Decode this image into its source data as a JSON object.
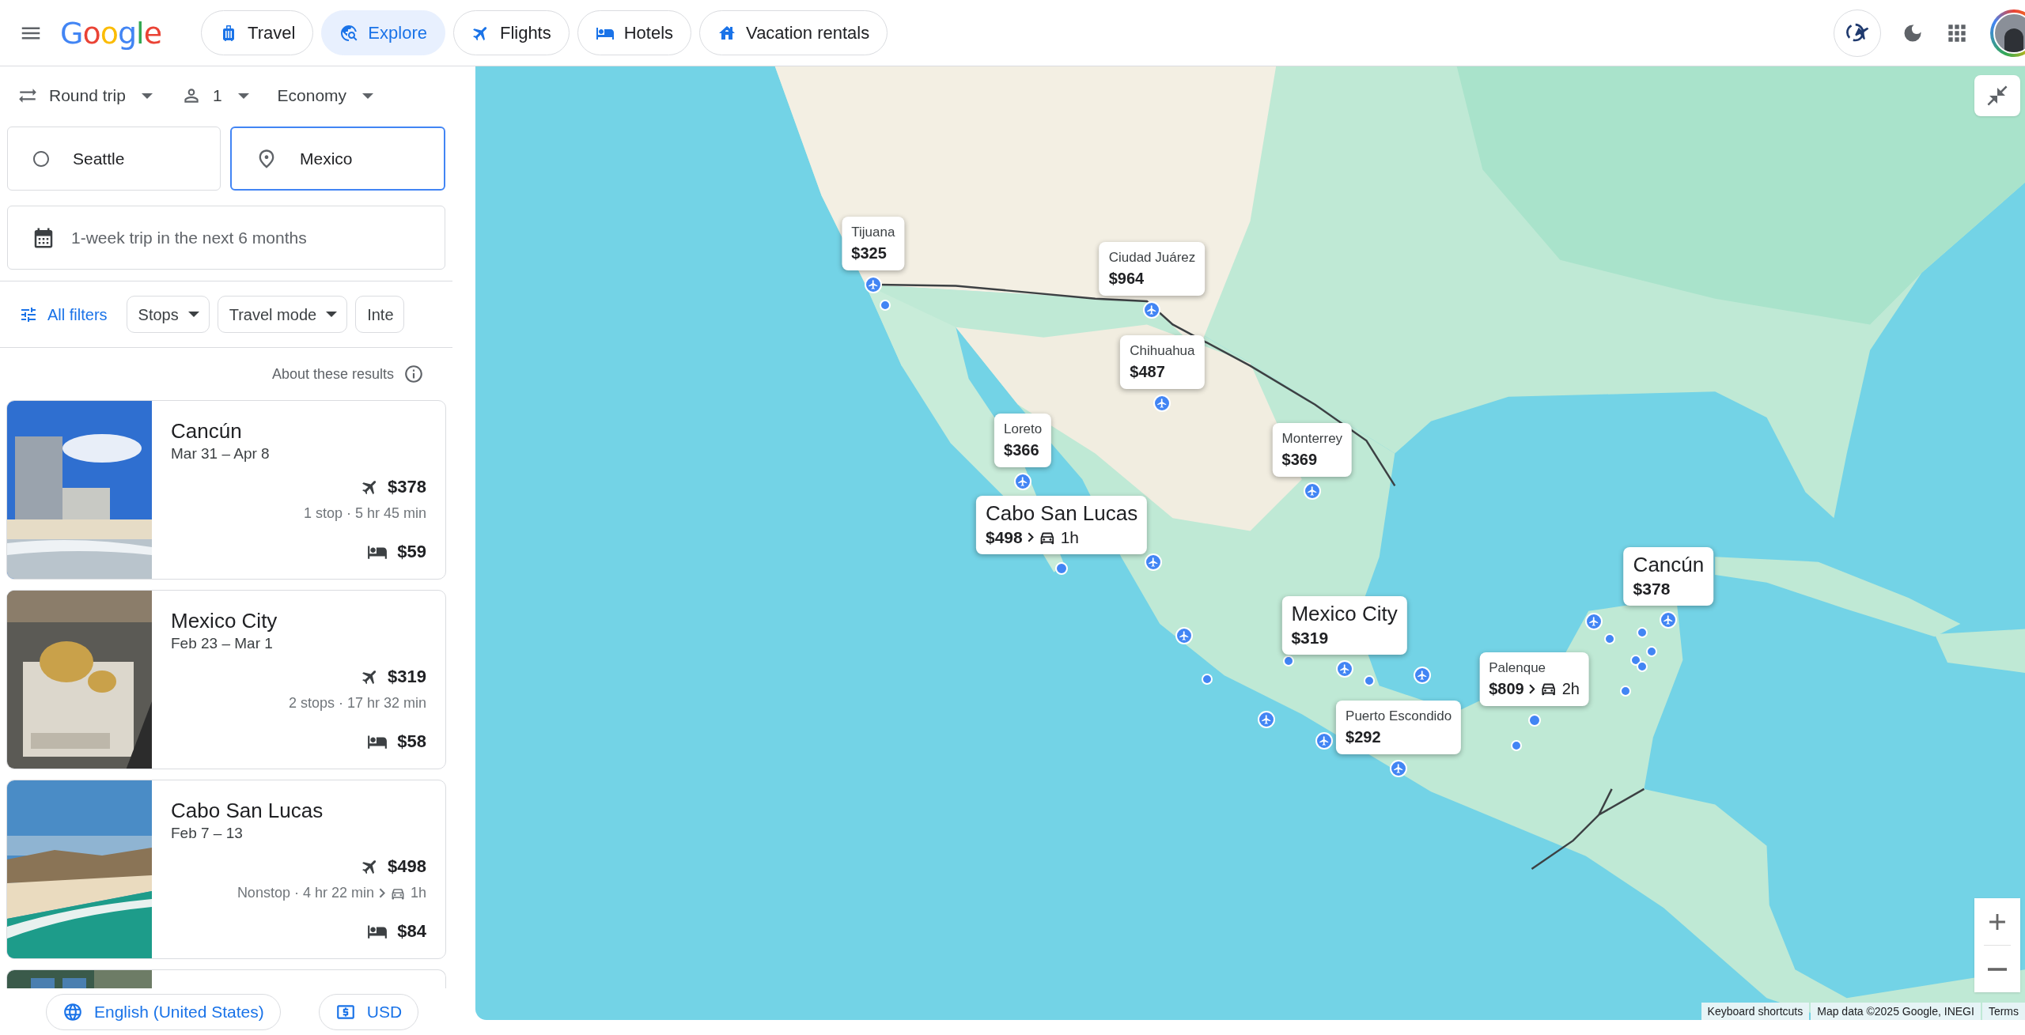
{
  "header": {
    "logo": "Google",
    "tabs": [
      {
        "kind": "travel",
        "label": "Travel",
        "selected": false
      },
      {
        "kind": "explore",
        "label": "Explore",
        "selected": true
      },
      {
        "kind": "flights",
        "label": "Flights",
        "selected": false
      },
      {
        "kind": "hotels",
        "label": "Hotels",
        "selected": false
      },
      {
        "kind": "rentals",
        "label": "Vacation rentals",
        "selected": false
      }
    ]
  },
  "search": {
    "options": [
      {
        "kind": "trip",
        "label": "Round trip"
      },
      {
        "kind": "passengers",
        "label": "1"
      },
      {
        "kind": "class",
        "label": "Economy"
      }
    ],
    "origin": {
      "value": "Seattle",
      "focused": false
    },
    "destination": {
      "value": "Mexico",
      "focused": true
    },
    "dates": {
      "value": "1-week trip in the next 6 months"
    }
  },
  "filters": {
    "all_filters": "All filters",
    "chips": [
      "Stops",
      "Travel mode",
      "Inte"
    ]
  },
  "about": "About these results",
  "results": [
    {
      "kind": "full",
      "name": "Cancún",
      "dates": "Mar 31 – Apr 8",
      "flight_price": "$378",
      "flight_details": "1 stop · 5 hr 45 min",
      "hotel_price": "$59"
    },
    {
      "kind": "full",
      "name": "Mexico City",
      "dates": "Feb 23 – Mar 1",
      "flight_price": "$319",
      "flight_details": "2 stops · 17 hr 32 min",
      "hotel_price": "$58"
    },
    {
      "kind": "full",
      "name": "Cabo San Lucas",
      "dates": "Feb 7 – 13",
      "flight_price": "$498",
      "flight_details": "Nonstop · 4 hr 22 min",
      "transfer": "1h",
      "hotel_price": "$84"
    },
    {
      "kind": "partial"
    }
  ],
  "footer": {
    "language": "English (United States)",
    "currency": "USD"
  },
  "map": {
    "markers": [
      {
        "kind": "small",
        "airport": true,
        "city": "Tijuana",
        "price": "$325"
      },
      {
        "kind": "small",
        "airport": true,
        "city": "Ciudad Juárez",
        "price": "$964"
      },
      {
        "kind": "small",
        "airport": true,
        "city": "Chihuahua",
        "price": "$487"
      },
      {
        "kind": "small",
        "airport": true,
        "city": "Loreto",
        "price": "$366"
      },
      {
        "kind": "small",
        "airport": true,
        "city": "Monterrey",
        "price": "$369"
      },
      {
        "kind": "large",
        "airport": false,
        "city": "Cabo San Lucas",
        "price": "$498",
        "transfer": "1h"
      },
      {
        "kind": "large",
        "airport": true,
        "city": "Cancún",
        "price": "$378"
      },
      {
        "kind": "large",
        "airport": true,
        "city": "Mexico City",
        "price": "$319"
      },
      {
        "kind": "small",
        "airport": false,
        "city": "Palenque",
        "price": "$809",
        "transfer": "2h"
      },
      {
        "kind": "small",
        "airport": true,
        "city": "Puerto Escondido",
        "price": "$292"
      }
    ],
    "attribution": [
      "Keyboard shortcuts",
      "Map data ©2025 Google, INEGI",
      "Terms"
    ]
  }
}
